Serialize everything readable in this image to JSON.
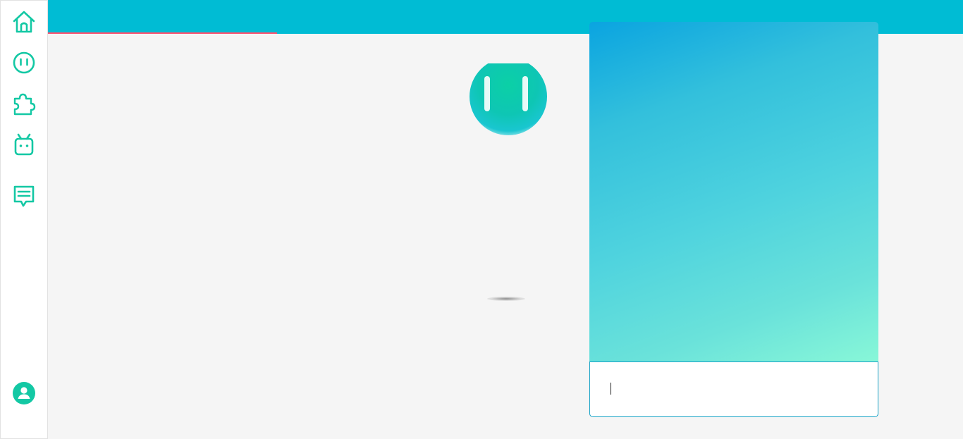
{
  "sidebar": {
    "items": [
      {
        "name": "home",
        "icon": "home-icon"
      },
      {
        "name": "power",
        "icon": "outlet-icon"
      },
      {
        "name": "plugins",
        "icon": "puzzle-icon"
      },
      {
        "name": "bot",
        "icon": "tv-bot-icon"
      },
      {
        "name": "chat",
        "icon": "message-icon"
      }
    ],
    "user_icon": "user-icon"
  },
  "theme": {
    "accent": "#13c8a4",
    "topbar": "#00bcd4",
    "progress": "#ff4f6d"
  },
  "loading": {
    "progress_fraction": 0.25
  },
  "chat": {
    "input_value": "",
    "input_placeholder": ""
  }
}
